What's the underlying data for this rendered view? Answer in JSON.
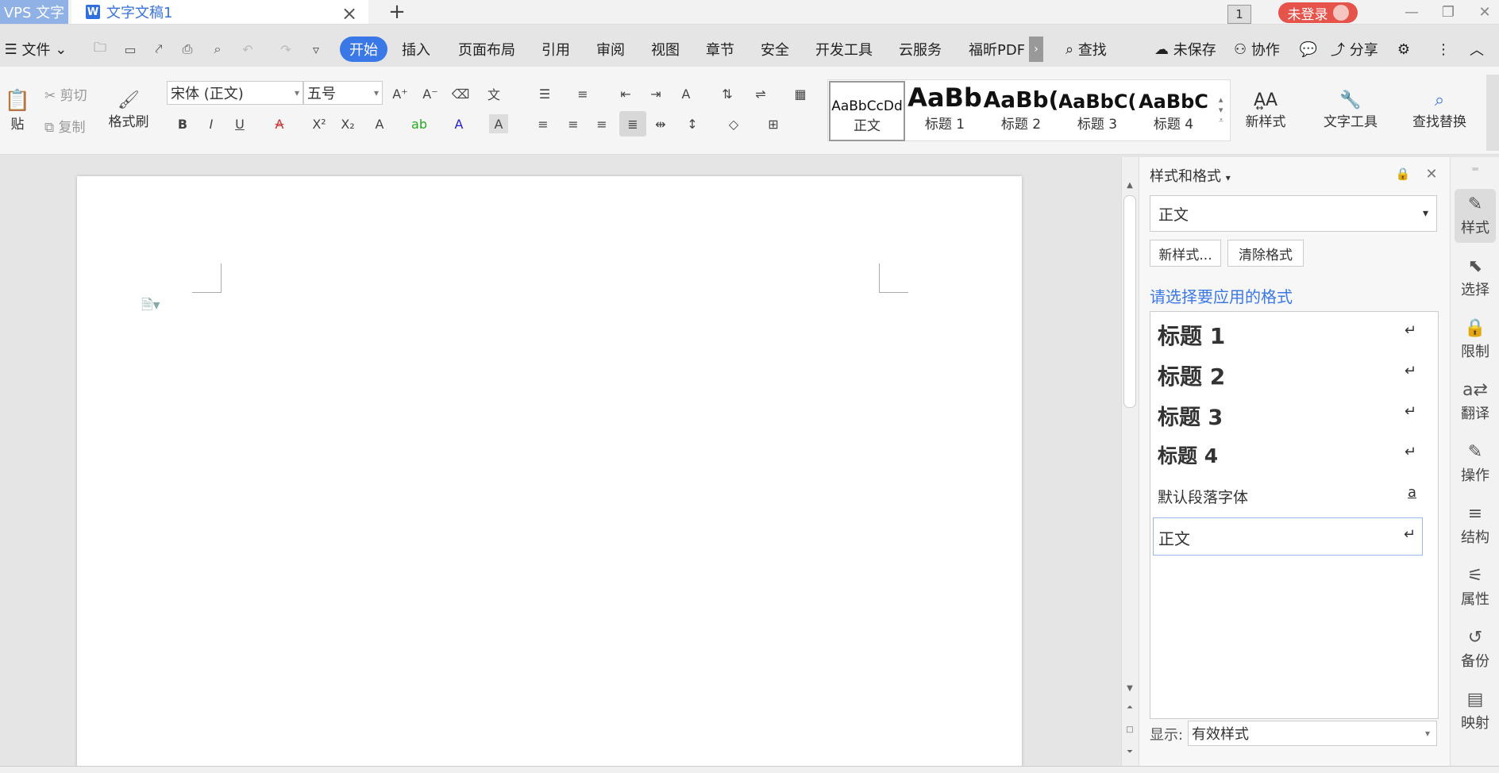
{
  "titlebar": {
    "app_tab": "VPS 文字",
    "doc_tab": "文字文稿1",
    "doc_icon": "W",
    "badge": "1",
    "login": "未登录"
  },
  "menu": {
    "file": "文件",
    "items": [
      "开始",
      "插入",
      "页面布局",
      "引用",
      "审阅",
      "视图",
      "章节",
      "安全",
      "开发工具",
      "云服务",
      "福昕PDF"
    ],
    "search": "查找",
    "unsaved": "未保存",
    "collab": "协作",
    "share": "分享"
  },
  "ribbon": {
    "paste": "贴",
    "cut": "剪切",
    "copy": "复制",
    "format_painter": "格式刷",
    "font": "宋体 (正文)",
    "size": "五号",
    "styles": [
      {
        "preview": "AaBbCcDd",
        "label": "正文"
      },
      {
        "preview": "AaBb",
        "label": "标题 1"
      },
      {
        "preview": "AaBb(",
        "label": "标题 2"
      },
      {
        "preview": "AaBbC(",
        "label": "标题 3"
      },
      {
        "preview": "AaBbC",
        "label": "标题 4"
      }
    ],
    "new_style": "新样式",
    "text_tools": "文字工具",
    "find_replace": "查找替换"
  },
  "panel": {
    "title": "样式和格式",
    "current": "正文",
    "new_style_btn": "新样式...",
    "clear_btn": "清除格式",
    "hint": "请选择要应用的格式",
    "styles": [
      {
        "name": "标题  1",
        "mark": "↵"
      },
      {
        "name": "标题  2",
        "mark": "↵"
      },
      {
        "name": "标题  3",
        "mark": "↵"
      },
      {
        "name": "标题  4",
        "mark": "↵"
      },
      {
        "name": "默认段落字体",
        "mark": "a"
      },
      {
        "name": "正文",
        "mark": "↵"
      }
    ],
    "show_label": "显示:",
    "show_value": "有效样式"
  },
  "rail": [
    {
      "label": "样式",
      "icon": "pen-icon"
    },
    {
      "label": "选择",
      "icon": "cursor-icon"
    },
    {
      "label": "限制",
      "icon": "lock-icon"
    },
    {
      "label": "翻译",
      "icon": "translate-icon"
    },
    {
      "label": "操作",
      "icon": "edit-icon"
    },
    {
      "label": "结构",
      "icon": "structure-icon"
    },
    {
      "label": "属性",
      "icon": "sliders-icon"
    },
    {
      "label": "备份",
      "icon": "history-icon"
    },
    {
      "label": "映射",
      "icon": "map-icon"
    }
  ]
}
